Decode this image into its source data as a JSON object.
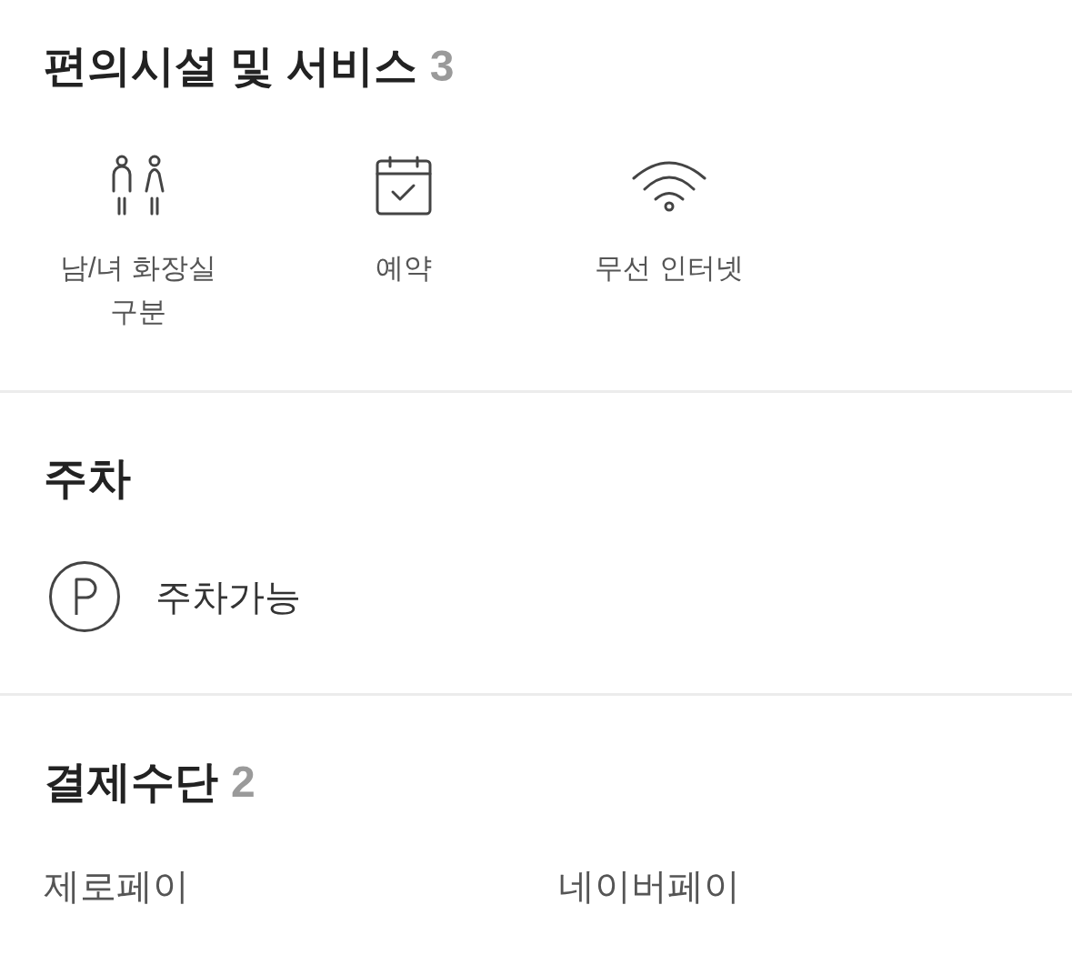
{
  "sections": [
    {
      "kind": "amenities",
      "title": "편의시설 및 서비스",
      "count": "3",
      "items": [
        {
          "label": "남/녀 화장실 구분"
        },
        {
          "label": "예약"
        },
        {
          "label": "무선 인터넷"
        }
      ]
    },
    {
      "kind": "parking",
      "title": "주차",
      "items": [
        {
          "label": "주차가능"
        }
      ]
    },
    {
      "kind": "payment",
      "title": "결제수단",
      "count": "2",
      "items": [
        {
          "label": "제로페이"
        },
        {
          "label": "네이버페이"
        }
      ]
    }
  ]
}
